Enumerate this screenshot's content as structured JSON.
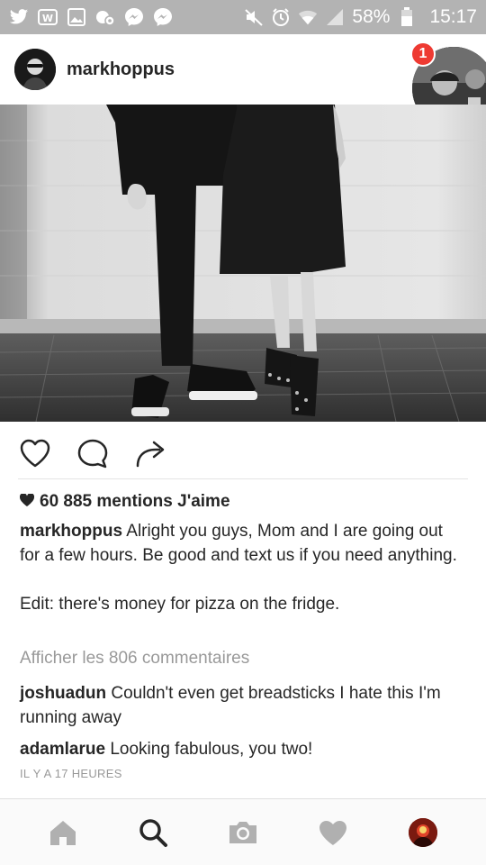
{
  "status_bar": {
    "icons_left": [
      "twitter-icon",
      "app-w-icon",
      "gallery-icon",
      "call-settings-icon",
      "messenger-icon",
      "messenger-icon"
    ],
    "icons_right": [
      "mute-icon",
      "alarm-icon",
      "wifi-icon",
      "signal-icon",
      "battery-icon"
    ],
    "battery": "58%",
    "time": "15:17"
  },
  "post": {
    "username": "markhoppus",
    "likes": "60 885 mentions J'aime",
    "caption_user": "markhoppus",
    "caption_text": "Alright you guys, Mom and I are going out for a few hours. Be good and text us if you need anything.",
    "caption_edit": "Edit: there's money for pizza on the fridge.",
    "view_comments": "Afficher les 806 commentaires",
    "comments": [
      {
        "user": "joshuadun",
        "text": "Couldn't even get breadsticks I hate this I'm running away"
      },
      {
        "user": "adamlarue",
        "text": "Looking fabulous, you two!"
      }
    ],
    "timestamp": "IL Y A 17 HEURES"
  },
  "chat_head": {
    "badge": "1"
  },
  "actions": [
    "heart-icon",
    "comment-icon",
    "share-icon"
  ],
  "bottom_nav": [
    "home-icon",
    "search-icon",
    "camera-icon",
    "activity-heart-icon",
    "profile-avatar"
  ],
  "colors": {
    "status_bar": "#b3b3b3",
    "badge": "#ee3a32",
    "muted_text": "#999999",
    "text": "#262626"
  }
}
